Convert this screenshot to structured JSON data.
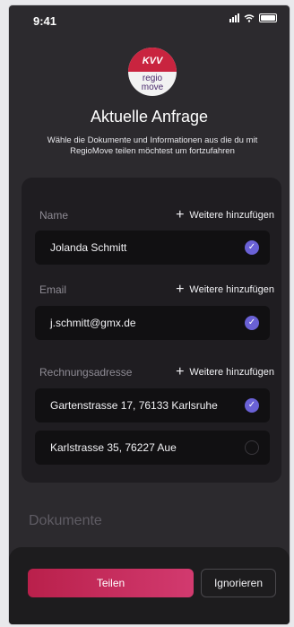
{
  "status_bar": {
    "time": "9:41"
  },
  "logo": {
    "top_text": "KVV",
    "bottom_text_1": "regio",
    "bottom_text_2": "move"
  },
  "header": {
    "title": "Aktuelle Anfrage",
    "subtitle": "Wähle die Dokumente und Informationen aus die du mit RegioMove teilen möchtest um fortzufahren"
  },
  "sections": {
    "name": {
      "label": "Name",
      "add_label": "Weitere hinzufügen",
      "options": [
        {
          "text": "Jolanda Schmitt",
          "selected": true
        }
      ]
    },
    "email": {
      "label": "Email",
      "add_label": "Weitere hinzufügen",
      "options": [
        {
          "text": "j.schmitt@gmx.de",
          "selected": true
        }
      ]
    },
    "billing": {
      "label": "Rechnungsadresse",
      "add_label": "Weitere hinzufügen",
      "options": [
        {
          "text": "Gartenstrasse 17, 76133 Karlsruhe",
          "selected": true
        },
        {
          "text": "Karlstrasse 35, 76227 Aue",
          "selected": false
        }
      ]
    }
  },
  "documents": {
    "label": "Dokumente"
  },
  "actions": {
    "share_label": "Teilen",
    "ignore_label": "Ignorieren"
  },
  "colors": {
    "accent": "#6a61d6",
    "primary_gradient_start": "#b9204b",
    "primary_gradient_end": "#d23a6f"
  }
}
